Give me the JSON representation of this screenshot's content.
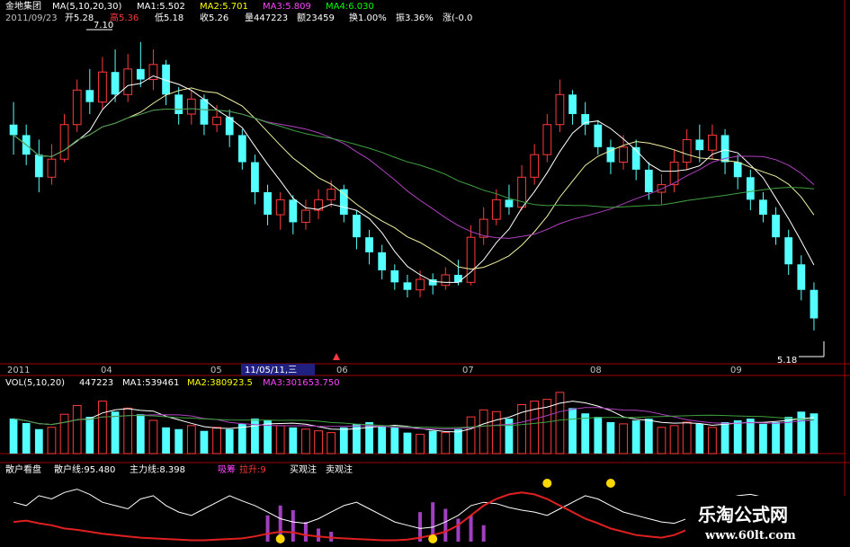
{
  "header": {
    "stock_name": "金地集团",
    "ma_params": "MA(5,10,20,30)",
    "ma1": "MA1:5.502",
    "ma2": "MA2:5.701",
    "ma3": "MA3:5.809",
    "ma4": "MA4:6.030",
    "date": "2011/09/23",
    "open": "开5.28",
    "high": "高5.36",
    "low": "低5.18",
    "close": "收5.26",
    "volume": "量447223",
    "amount": "额23459",
    "turnover": "换1.00%",
    "amplitude": "振3.36%",
    "change": "涨(-0.0"
  },
  "price_panel": {
    "high_marker": "7.10",
    "low_marker": "5.18"
  },
  "time_axis": {
    "labels": [
      "2011",
      "04",
      "05",
      "06",
      "07",
      "08",
      "09"
    ],
    "cursor_label": "11/05/11,三"
  },
  "volume_panel": {
    "header": "VOL(5,10,20)",
    "value": "447223",
    "ma1": "MA1:539461",
    "ma2": "MA2:380923.5",
    "ma3": "MA3:301653.750"
  },
  "indicator_panel": {
    "name": "散户看盘",
    "retail_line": "散户线:95.480",
    "main_line": "主力线:8.398",
    "suck": "吸筹",
    "raise": "拉升:9",
    "buy": "买观注",
    "sell": "卖观注"
  },
  "watermark": {
    "title": "乐淘公式网",
    "url": "www.60lt.com"
  },
  "colors": {
    "up": "#ff3a3a",
    "down": "#54ffff",
    "ma1": "#ffffff",
    "ma2": "#ffff00",
    "ma3": "#ff44ff",
    "ma4": "#00ff00",
    "ma_line_purple": "#b040c0",
    "ma_line_green": "#40a040"
  },
  "chart_data": {
    "type": "candlestick",
    "ylim": [
      5.0,
      7.2
    ],
    "high_value": 7.1,
    "low_value": 5.18,
    "candles": [
      [
        6.55,
        6.48,
        6.7,
        6.35,
        1
      ],
      [
        6.48,
        6.35,
        6.55,
        6.28,
        1
      ],
      [
        6.35,
        6.2,
        6.45,
        6.1,
        1
      ],
      [
        6.2,
        6.32,
        6.42,
        6.15,
        0
      ],
      [
        6.32,
        6.55,
        6.62,
        6.3,
        0
      ],
      [
        6.55,
        6.78,
        6.85,
        6.5,
        0
      ],
      [
        6.78,
        6.7,
        6.92,
        6.62,
        1
      ],
      [
        6.7,
        6.9,
        7.0,
        6.65,
        0
      ],
      [
        6.9,
        6.75,
        7.05,
        6.7,
        1
      ],
      [
        6.75,
        6.92,
        7.02,
        6.7,
        0
      ],
      [
        6.92,
        6.85,
        7.1,
        6.8,
        1
      ],
      [
        6.85,
        6.95,
        7.05,
        6.78,
        0
      ],
      [
        6.95,
        6.75,
        6.98,
        6.68,
        1
      ],
      [
        6.75,
        6.62,
        6.8,
        6.55,
        1
      ],
      [
        6.62,
        6.72,
        6.78,
        6.55,
        0
      ],
      [
        6.72,
        6.55,
        6.75,
        6.48,
        1
      ],
      [
        6.55,
        6.6,
        6.68,
        6.5,
        0
      ],
      [
        6.6,
        6.48,
        6.65,
        6.4,
        1
      ],
      [
        6.48,
        6.3,
        6.52,
        6.25,
        1
      ],
      [
        6.3,
        6.1,
        6.35,
        6.02,
        1
      ],
      [
        6.1,
        5.95,
        6.15,
        5.88,
        1
      ],
      [
        5.95,
        6.05,
        6.1,
        5.85,
        0
      ],
      [
        6.05,
        5.9,
        6.08,
        5.82,
        1
      ],
      [
        5.9,
        5.98,
        6.05,
        5.85,
        0
      ],
      [
        5.98,
        6.05,
        6.12,
        5.92,
        0
      ],
      [
        6.05,
        6.12,
        6.18,
        6.0,
        0
      ],
      [
        6.12,
        5.95,
        6.15,
        5.9,
        1
      ],
      [
        5.95,
        5.8,
        5.98,
        5.72,
        1
      ],
      [
        5.8,
        5.7,
        5.85,
        5.62,
        1
      ],
      [
        5.7,
        5.58,
        5.75,
        5.52,
        1
      ],
      [
        5.58,
        5.5,
        5.62,
        5.45,
        1
      ],
      [
        5.5,
        5.45,
        5.55,
        5.4,
        1
      ],
      [
        5.45,
        5.52,
        5.58,
        5.4,
        0
      ],
      [
        5.52,
        5.48,
        5.56,
        5.42,
        1
      ],
      [
        5.48,
        5.55,
        5.6,
        5.45,
        0
      ],
      [
        5.55,
        5.5,
        5.65,
        5.48,
        1
      ],
      [
        5.5,
        5.8,
        5.88,
        5.48,
        0
      ],
      [
        5.8,
        5.92,
        6.0,
        5.75,
        0
      ],
      [
        5.92,
        6.05,
        6.12,
        5.88,
        0
      ],
      [
        6.05,
        6.0,
        6.15,
        5.95,
        1
      ],
      [
        6.0,
        6.2,
        6.28,
        5.98,
        0
      ],
      [
        6.2,
        6.35,
        6.42,
        6.15,
        0
      ],
      [
        6.35,
        6.55,
        6.62,
        6.3,
        0
      ],
      [
        6.55,
        6.75,
        6.85,
        6.5,
        0
      ],
      [
        6.75,
        6.62,
        6.78,
        6.55,
        1
      ],
      [
        6.62,
        6.55,
        6.7,
        6.48,
        1
      ],
      [
        6.55,
        6.4,
        6.58,
        6.35,
        1
      ],
      [
        6.4,
        6.3,
        6.45,
        6.22,
        1
      ],
      [
        6.3,
        6.4,
        6.48,
        6.25,
        0
      ],
      [
        6.4,
        6.25,
        6.45,
        6.18,
        1
      ],
      [
        6.25,
        6.1,
        6.3,
        6.05,
        1
      ],
      [
        6.1,
        6.15,
        6.22,
        6.02,
        0
      ],
      [
        6.15,
        6.3,
        6.38,
        6.1,
        0
      ],
      [
        6.3,
        6.45,
        6.52,
        6.25,
        0
      ],
      [
        6.45,
        6.38,
        6.55,
        6.3,
        1
      ],
      [
        6.38,
        6.48,
        6.55,
        6.32,
        0
      ],
      [
        6.48,
        6.3,
        6.52,
        6.22,
        1
      ],
      [
        6.3,
        6.2,
        6.35,
        6.12,
        1
      ],
      [
        6.2,
        6.05,
        6.25,
        5.98,
        1
      ],
      [
        6.05,
        5.95,
        6.1,
        5.9,
        1
      ],
      [
        5.95,
        5.8,
        6.0,
        5.75,
        1
      ],
      [
        5.8,
        5.62,
        5.85,
        5.55,
        1
      ],
      [
        5.62,
        5.45,
        5.68,
        5.38,
        1
      ],
      [
        5.45,
        5.26,
        5.5,
        5.18,
        1
      ]
    ],
    "volume": [
      40,
      35,
      28,
      30,
      45,
      55,
      42,
      60,
      48,
      52,
      45,
      38,
      30,
      28,
      32,
      26,
      30,
      28,
      34,
      40,
      38,
      32,
      30,
      28,
      26,
      24,
      30,
      34,
      36,
      32,
      30,
      24,
      22,
      26,
      24,
      28,
      42,
      50,
      48,
      40,
      56,
      60,
      62,
      70,
      52,
      46,
      42,
      36,
      34,
      38,
      40,
      30,
      32,
      36,
      34,
      30,
      36,
      38,
      40,
      34,
      36,
      42,
      48,
      46
    ],
    "retail_line": [
      60,
      55,
      70,
      65,
      75,
      80,
      72,
      60,
      55,
      50,
      65,
      70,
      55,
      45,
      40,
      50,
      60,
      70,
      62,
      55,
      45,
      35,
      30,
      28,
      35,
      45,
      55,
      60,
      50,
      40,
      30,
      25,
      20,
      22,
      30,
      40,
      55,
      60,
      58,
      52,
      48,
      45,
      40,
      50,
      60,
      70,
      65,
      55,
      45,
      40,
      35,
      30,
      28,
      35,
      45,
      55,
      65,
      70,
      72,
      68,
      60,
      50,
      40,
      30
    ],
    "main_line": [
      30,
      32,
      28,
      25,
      20,
      18,
      15,
      12,
      10,
      8,
      6,
      5,
      4,
      3,
      2,
      2,
      3,
      4,
      5,
      8,
      12,
      15,
      14,
      10,
      8,
      6,
      5,
      4,
      3,
      2,
      2,
      3,
      6,
      10,
      15,
      25,
      40,
      55,
      65,
      72,
      75,
      72,
      65,
      55,
      45,
      35,
      28,
      20,
      15,
      10,
      8,
      6,
      10,
      18,
      30,
      45,
      58,
      65,
      62,
      55,
      45,
      35,
      25,
      15
    ],
    "bars": [
      0,
      0,
      0,
      0,
      0,
      0,
      0,
      0,
      0,
      0,
      0,
      0,
      0,
      0,
      0,
      0,
      0,
      0,
      0,
      0,
      40,
      55,
      48,
      30,
      20,
      15,
      0,
      0,
      0,
      0,
      0,
      0,
      45,
      60,
      50,
      35,
      40,
      25,
      0,
      0,
      0,
      0,
      0,
      0,
      0,
      0,
      0,
      0,
      0,
      0,
      0,
      0,
      0,
      0,
      0,
      0,
      20,
      25,
      15,
      10,
      0,
      0,
      0,
      0
    ]
  }
}
